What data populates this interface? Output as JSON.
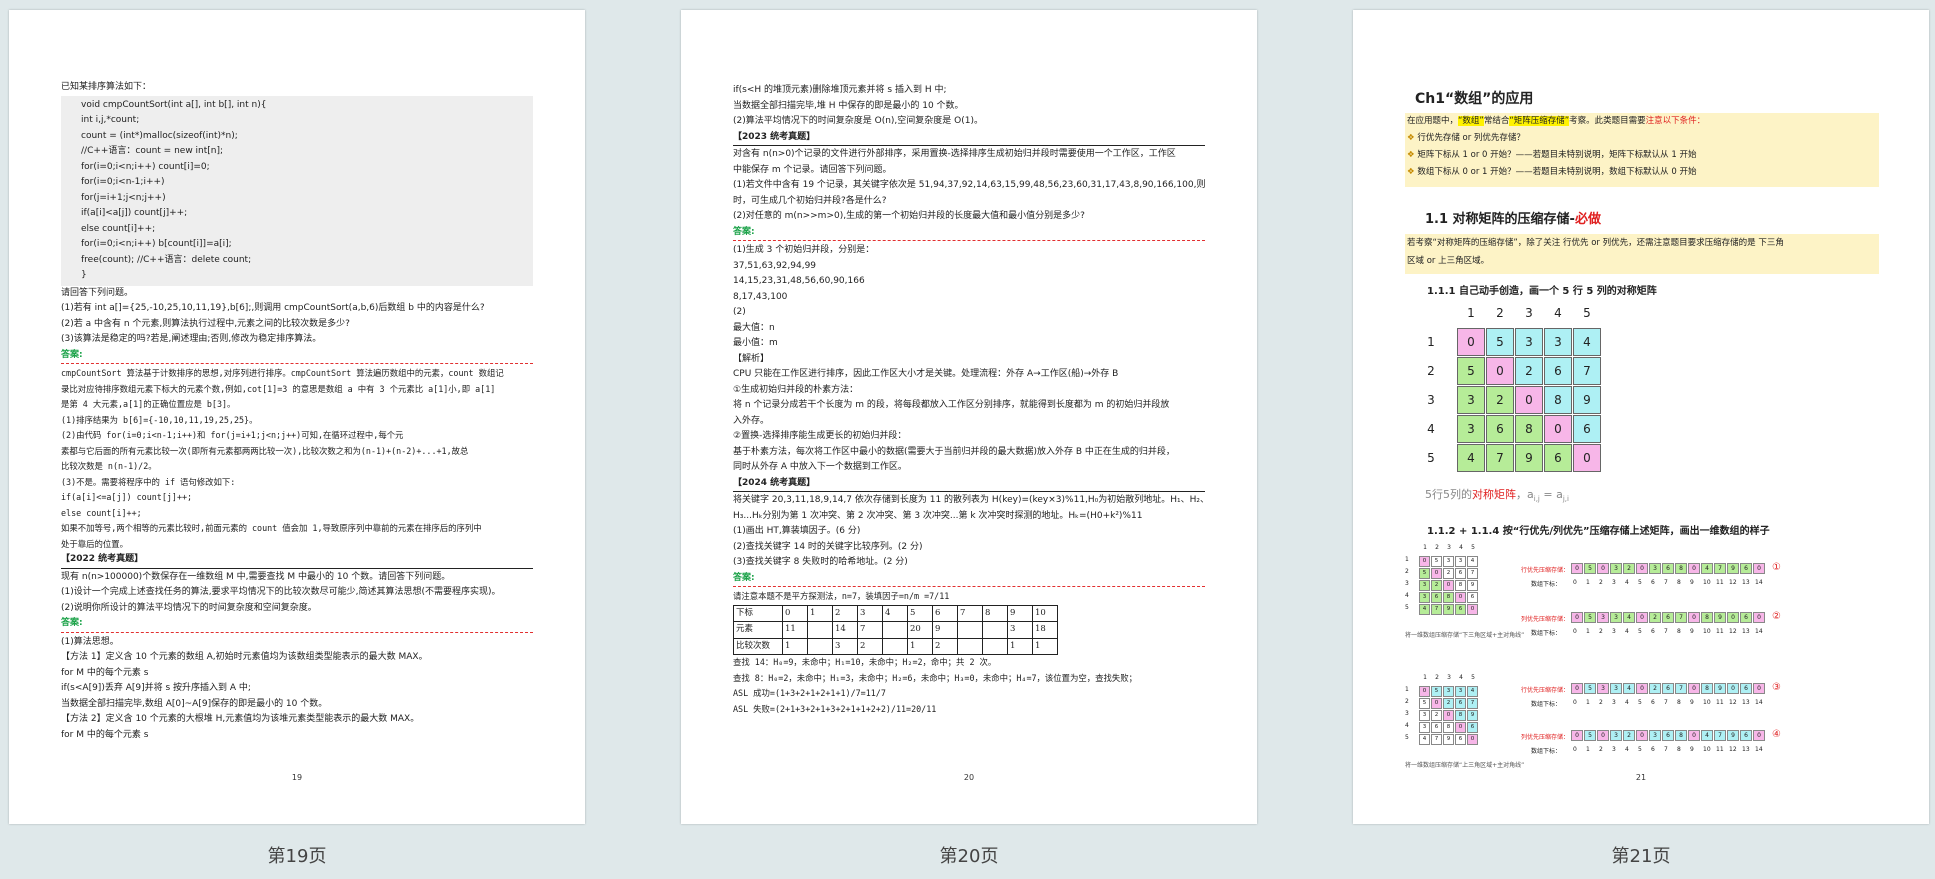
{
  "captions": {
    "p19": "第19页",
    "p20": "第20页",
    "p21": "第21页"
  },
  "page_numbers": {
    "p19": "19",
    "p20": "20",
    "p21": "21"
  },
  "p19": {
    "intro": "已知某排序算法如下：",
    "code": [
      "void cmpCountSort(int a[], int b[], int n){",
      "    int i,j,*count;",
      "    count = (int*)malloc(sizeof(int)*n);",
      "                                        //C++语言：count = new int[n];",
      "    for(i=0;i<n;i++)                    count[i]=0;",
      "    for(i=0;i<n-1;i++)",
      "        for(j=i+1;j<n;j++)",
      "            if(a[i]<a[j])        count[j]++;",
      "            else        count[i]++;",
      "    for(i=0;i<n;i++)        b[count[i]]=a[i];",
      "    free(count);        //C++语言：delete count;",
      "}"
    ],
    "q_lines": [
      "请回答下列问题。",
      "(1)若有 int a[]={25,-10,25,10,11,19},b[6];,则调用 cmpCountSort(a,b,6)后数组 b 中的内容是什么?",
      "(2)若 a 中含有 n 个元素,则算法执行过程中,元素之间的比较次数是多少?",
      "(3)该算法是稳定的吗?若是,阐述理由;否则,修改为稳定排序算法。"
    ],
    "answer_label": "答案:",
    "a_lines": [
      "cmpCountSort 算法基于计数排序的思想,对序列进行排序。cmpCountSort 算法遍历数组中的元素，count 数组记",
      "录比对应待排序数组元素下标大的元素个数,例如,cot[1]=3 的意思是数组 a 中有 3 个元素比 a[1]小,即 a[1]",
      "是第 4 大元素,a[1]的正确位置应是 b[3]。",
      "(1)排序结果为 b[6]={-10,10,11,19,25,25}。",
      "(2)由代码 for(i=0;i<n-1;i++)和 for(j=i+1;j<n;j++)可知,在循环过程中,每个元",
      "素都与它后面的所有元素比较一次(即所有元素都两两比较一次),比较次数之和为(n-1)+(n-2)+...+1,故总",
      "比较次数是 n(n-1)/2。",
      "(3)不是。需要将程序中的 if 语句修改如下:",
      "if(a[i]<=a[j])        count[j]++;",
      "else count[i]++;",
      "如果不加等号,两个相等的元素比较时,前面元素的 count 值会加 1,导致原序列中靠前的元素在排序后的序列中",
      "处于靠后的位置。"
    ],
    "sec2022": "【2022 统考真题】",
    "q2022": [
      "现有 n(n>100000)个数保存在一维数组 M 中,需要查找 M 中最小的 10 个数。请回答下列问题。",
      "(1)设计一个完成上述查找任务的算法,要求平均情况下的比较次数尽可能少,简述其算法思想(不需要程序实现)。",
      "(2)说明你所设计的算法平均情况下的时间复杂度和空间复杂度。"
    ],
    "a2022": [
      "(1)算法思想。",
      "【方法 1】定义含 10 个元素的数组 A,初始时元素值均为该数组类型能表示的最大数 MAX。",
      "for M 中的每个元素 s",
      "if(s<A[9])丢弃 A[9]并将 s 按升序插入到 A 中;",
      "当数据全部扫描完毕,数组 A[0]~A[9]保存的即是最小的 10 个数。",
      "【方法 2】定义含 10 个元素的大根堆 H,元素值均为该堆元素类型能表示的最大数 MAX。",
      "for M 中的每个元素 s"
    ]
  },
  "p20": {
    "top": [
      "if(s<H 的堆顶元素)删除堆顶元素并将 s 插入到 H 中;",
      "当数据全部扫描完毕,堆 H 中保存的即是最小的 10 个数。",
      "(2)算法平均情况下的时间复杂度是 O(n),空间复杂度是 O(1)。"
    ],
    "sec2023": "【2023 统考真题】",
    "q2023": [
      "对含有 n(n>0)个记录的文件进行外部排序，采用置换-选择排序生成初始归并段时需要使用一个工作区，工作区",
      "中能保存 m 个记录。请回答下列问题。",
      "(1)若文件中含有 19 个记录，其关键字依次是 51,94,37,92,14,63,15,99,48,56,23,60,31,17,43,8,90,166,100,则当 m=4",
      "时，可生成几个初始归并段?各是什么?",
      "(2)对任意的 m(n>>m>0),生成的第一个初始归并段的长度最大值和最小值分别是多少?"
    ],
    "answer_label": "答案:",
    "a2023": [
      "(1)生成 3 个初始归并段，分别是：",
      "  37,51,63,92,94,99",
      "  14,15,23,31,48,56,60,90,166",
      "  8,17,43,100",
      "(2)",
      "  最大值：n",
      "  最小值：m",
      "【解析】",
      "CPU 只能在工作区进行排序，因此工作区大小才是关键。处理流程：外存 A→工作区(船)→外存 B",
      "①生成初始归并段的朴素方法：",
      "  将 n 个记录分成若干个长度为 m 的段，将每段都放入工作区分别排序，就能得到长度都为 m 的初始归并段放",
      "入外存。",
      "②置换-选择排序能生成更长的初始归并段：",
      "  基于朴素方法，每次将工作区中最小的数据(需要大于当前归并段的最大数据)放入外存 B 中正在生成的归并段，",
      "同时从外存 A 中放入下一个数据到工作区。"
    ],
    "sec2024": "【2024 统考真题】",
    "q2024": [
      "将关键字 20,3,11,18,9,14,7 依次存储到长度为 11 的散列表为 H(key)=(key×3)%11,H₀为初始散列地址。H₁、H₂、",
      "H₃...Hₖ分别为第 1 次冲突、第 2 次冲突、第 3 次冲突...第 k 次冲突时探测的地址。Hₖ=(H0+k²)%11",
      "(1)画出 HT,算装填因子。(6 分)",
      "(2)查找关键字 14 时的关键字比较序列。(2 分)",
      "(3)查找关键字 8 失败时的哈希地址。(2 分)"
    ],
    "a2024_head": "请注意本题不是平方探测法，n=7，装填因子=n/m =7/11",
    "hash_table": {
      "rows": [
        [
          "下标",
          "0",
          "1",
          "2",
          "3",
          "4",
          "5",
          "6",
          "7",
          "8",
          "9",
          "10"
        ],
        [
          "元素",
          "11",
          "",
          "14",
          "7",
          "",
          "20",
          "9",
          "",
          "",
          "3",
          "18"
        ],
        [
          "比较次数",
          "1",
          "",
          "3",
          "2",
          "",
          "1",
          "2",
          "",
          "",
          "1",
          "1"
        ]
      ]
    },
    "a2024_tail": [
      "查找 14：H₀=9，未命中；H₁=10，未命中；H₂=2，命中；共 2 次。",
      "查找 8：H₀=2，未命中；H₁=3，未命中；H₂=6，未命中；H₃=0，未命中；H₄=7，该位置为空，查找失败；",
      "ASL 成功=(1+3+2+1+2+1+1)/7=11/7",
      "ASL 失败=(2+1+3+2+1+3+2+1+1+2+2)/11=20/11"
    ]
  },
  "p21": {
    "title": "Ch1“数组”的应用",
    "box1": {
      "lead_a": "在应用题中，",
      "lead_b": "“数组”",
      "lead_c": "常结合",
      "lead_d": "“矩阵压缩存储”",
      "lead_e": "考察。此类题目需要",
      "lead_f": "注意以下条件：",
      "items": [
        "行优先存储 or 列优先存储？",
        "矩阵下标从 1 or 0 开始？——若题目未特别说明，矩阵下标默认从 1 开始",
        "数组下标从 0 or 1 开始？——若题目未特别说明，数组下标默认从 0 开始"
      ]
    },
    "h11": "1.1 对称矩阵的压缩存储-",
    "h11_must": "必做",
    "box2": [
      "若考察“对称矩阵的压缩存储”，除了关注 行优先 or 列优先，还需注意题目要求压缩存储的是 下三角",
      "区域 or 上三角区域。"
    ],
    "h111": "1.1.1 自己动手创造，画一个 5 行 5 列的对称矩阵",
    "matrix_cols": [
      "1",
      "2",
      "3",
      "4",
      "5"
    ],
    "matrix_rows": [
      "1",
      "2",
      "3",
      "4",
      "5"
    ],
    "matrix": [
      [
        "0",
        "5",
        "3",
        "3",
        "4"
      ],
      [
        "5",
        "0",
        "2",
        "6",
        "7"
      ],
      [
        "3",
        "2",
        "0",
        "8",
        "9"
      ],
      [
        "3",
        "6",
        "8",
        "0",
        "6"
      ],
      [
        "4",
        "7",
        "9",
        "6",
        "0"
      ]
    ],
    "matrix_caption_a": "5行5列的",
    "matrix_caption_b": "对称矩阵",
    "matrix_caption_c": "，a",
    "h112": "1.1.2 + 1.1.4  按“行优先/列优先”压缩存储上述矩阵，画出一维数组的样子",
    "row_label": "行优先压缩存储：",
    "col_label": "列优先压缩存储：",
    "idx_label": "数组下标：",
    "lower_note": "将一维数组压缩存储“下三角区域+主对角线”",
    "upper_note": "将一维数组压缩存储“上三角区域+主对角线”",
    "circled": [
      "①",
      "②",
      "③",
      "④"
    ],
    "row_lower": [
      "0",
      "5",
      "0",
      "3",
      "2",
      "0",
      "3",
      "6",
      "8",
      "0",
      "4",
      "7",
      "9",
      "6",
      "0"
    ],
    "col_lower": [
      "0",
      "5",
      "3",
      "3",
      "4",
      "0",
      "2",
      "6",
      "7",
      "0",
      "8",
      "9",
      "0",
      "6",
      "0"
    ],
    "row_upper": [
      "0",
      "5",
      "3",
      "3",
      "4",
      "0",
      "2",
      "6",
      "7",
      "0",
      "8",
      "9",
      "0",
      "6",
      "0"
    ],
    "col_upper": [
      "0",
      "5",
      "0",
      "3",
      "2",
      "0",
      "3",
      "6",
      "8",
      "0",
      "4",
      "7",
      "9",
      "6",
      "0"
    ],
    "indices": [
      "0",
      "1",
      "2",
      "3",
      "4",
      "5",
      "6",
      "7",
      "8",
      "9",
      "10",
      "11",
      "12",
      "13",
      "14"
    ],
    "colors": {
      "pink": "#f7b6e8",
      "cyan": "#aef0f4",
      "green": "#b6ec98",
      "red": "#e02020",
      "answer": "#1da34a"
    }
  }
}
